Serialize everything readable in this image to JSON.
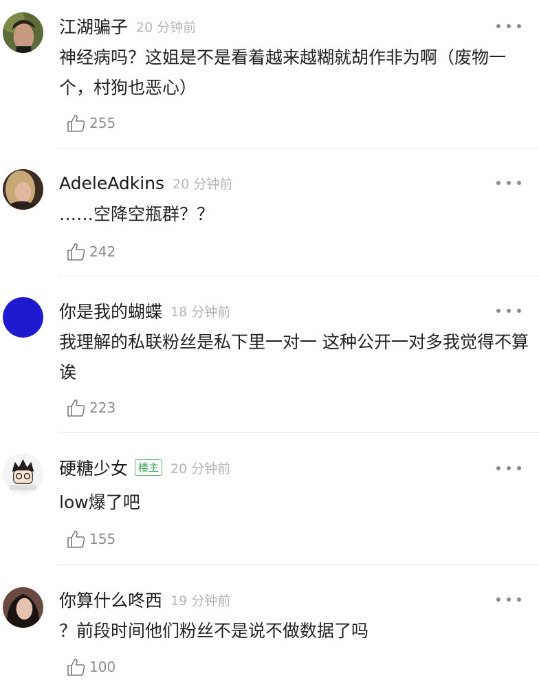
{
  "comments": [
    {
      "username": "江湖骗子",
      "time": "20 分钟前",
      "badge": "",
      "text": "神经病吗？这姐是不是看着越来越糊就胡作非为啊（废物一个，村狗也恶心）",
      "likes": "255"
    },
    {
      "username": "AdeleAdkins",
      "time": "20 分钟前",
      "badge": "",
      "text": "……空降空瓶群？？",
      "likes": "242"
    },
    {
      "username": "你是我的蝴蝶",
      "time": "18 分钟前",
      "badge": "",
      "text": "我理解的私联粉丝是私下里一对一 这种公开一对多我觉得不算诶",
      "likes": "223"
    },
    {
      "username": "硬糖少女",
      "time": "20 分钟前",
      "badge": "楼主",
      "text": "low爆了吧",
      "likes": "155"
    },
    {
      "username": "你算什么咚西",
      "time": "19 分钟前",
      "badge": "",
      "text": "？前段时间他们粉丝不是说不做数据了吗",
      "likes": "100"
    }
  ],
  "icons": {
    "more": "more-dots-icon",
    "like": "thumbs-up-icon"
  },
  "colors": {
    "badge_green": "#3aa654",
    "meta_gray": "#b4b4b4",
    "avatar3_blue": "#1d1ad0"
  }
}
